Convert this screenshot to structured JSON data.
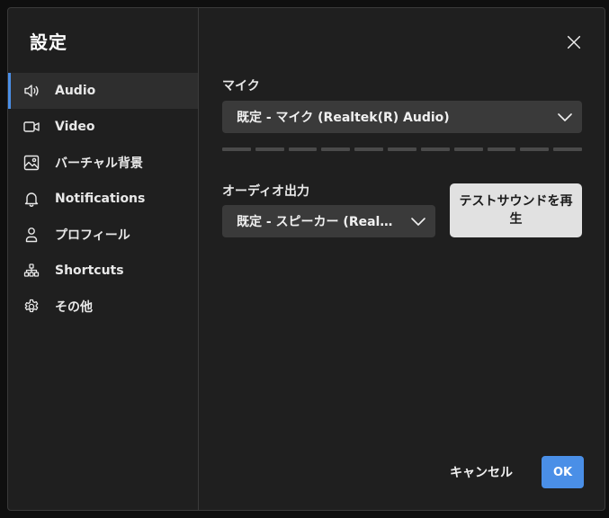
{
  "dialog": {
    "title": "設定",
    "close_icon": "close-icon"
  },
  "sidebar": {
    "active_index": 0,
    "items": [
      {
        "label": "Audio",
        "icon": "speaker-icon"
      },
      {
        "label": "Video",
        "icon": "video-camera-icon"
      },
      {
        "label": "バーチャル背景",
        "icon": "image-icon"
      },
      {
        "label": "Notifications",
        "icon": "bell-icon"
      },
      {
        "label": "プロフィール",
        "icon": "person-icon"
      },
      {
        "label": "Shortcuts",
        "icon": "shortcuts-icon"
      },
      {
        "label": "その他",
        "icon": "gear-icon"
      }
    ]
  },
  "audio": {
    "mic_label": "マイク",
    "mic_selected": "既定 - マイク (Realtek(R) Audio)",
    "mic_level_segments": 11,
    "mic_level_active": 0,
    "output_label": "オーディオ出力",
    "output_selected": "既定 - スピーカー (Realtek(R) Audio)",
    "test_sound_label": "テストサウンドを再生"
  },
  "footer": {
    "cancel_label": "キャンセル",
    "ok_label": "OK"
  },
  "colors": {
    "accent": "#4a8fe7",
    "dialog_bg": "#1f1f1f",
    "select_bg": "#3a3a3a",
    "meter_inactive": "#4a4a4a"
  }
}
